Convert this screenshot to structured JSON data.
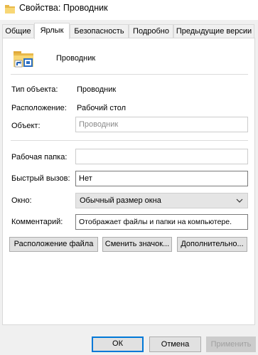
{
  "window": {
    "title": "Свойства: Проводник",
    "app_icon": "folder-icon"
  },
  "tabs": [
    {
      "label": "Общие",
      "active": false
    },
    {
      "label": "Ярлык",
      "active": true
    },
    {
      "label": "Безопасность",
      "active": false
    },
    {
      "label": "Подробно",
      "active": false
    },
    {
      "label": "Предыдущие версии",
      "active": false
    }
  ],
  "shortcut": {
    "name": "Проводник",
    "icon": "explorer-folder-shortcut-icon",
    "type_label": "Тип объекта:",
    "type_value": "Проводник",
    "location_label": "Расположение:",
    "location_value": "Рабочий стол",
    "target_label": "Объект:",
    "target_value": "Проводник",
    "workdir_label": "Рабочая папка:",
    "workdir_value": "",
    "hotkey_label": "Быстрый вызов:",
    "hotkey_value": "Нет",
    "window_label": "Окно:",
    "window_value": "Обычный размер окна",
    "comment_label": "Комментарий:",
    "comment_value": "Отображает файлы и папки на компьютере."
  },
  "actions": {
    "open_location": "Расположение файла",
    "change_icon": "Сменить значок...",
    "advanced": "Дополнительно..."
  },
  "footer": {
    "ok": "ОК",
    "cancel": "Отмена",
    "apply": "Применить"
  },
  "colors": {
    "accent": "#0078d7",
    "folder": "#f8d775",
    "window_bg": "#f0f0f0"
  }
}
